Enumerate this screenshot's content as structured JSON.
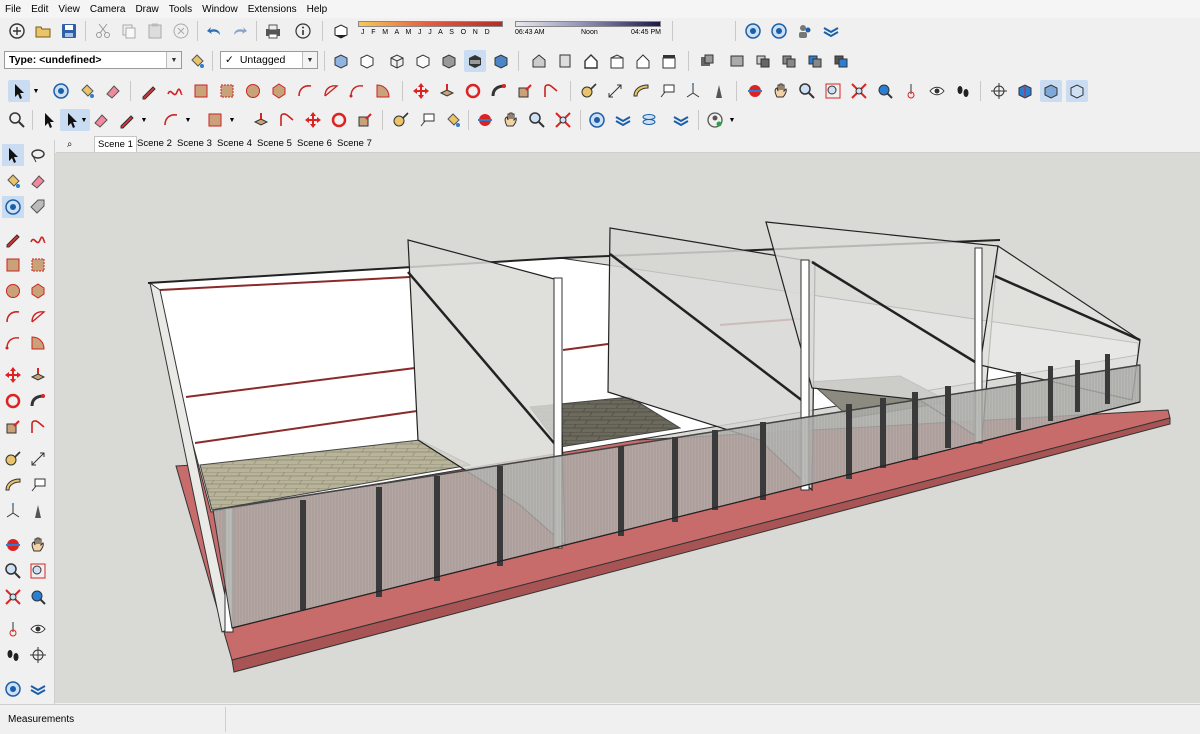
{
  "menu": [
    "File",
    "Edit",
    "View",
    "Camera",
    "Draw",
    "Tools",
    "Window",
    "Extensions",
    "Help"
  ],
  "entity_type": "Type: <undefined>",
  "tag_value": "Untagged",
  "tag_check": "✓",
  "shadow": {
    "months": "J F M A M J J A S O N D",
    "time_start": "06:43 AM",
    "time_noon": "Noon",
    "time_end": "04:45 PM"
  },
  "scenes": [
    "Scene 1",
    "Scene 2",
    "Scene 3",
    "Scene 4",
    "Scene 5",
    "Scene 6",
    "Scene 7"
  ],
  "status": {
    "measurements_label": "Measurements"
  },
  "colors": {
    "accent": "#1a5fa8",
    "viewport": "#d9d9d6",
    "curb": "#c86b6b",
    "floor": "#b8b49a"
  }
}
